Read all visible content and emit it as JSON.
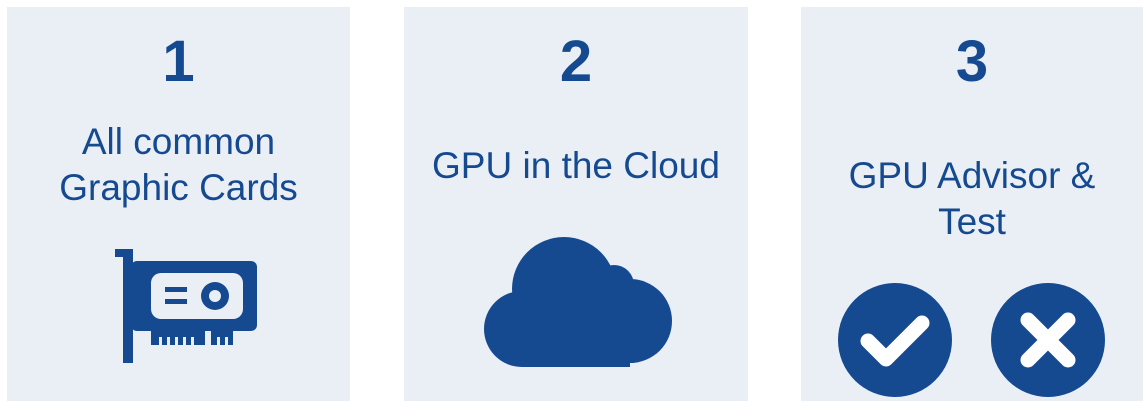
{
  "cards": [
    {
      "number": "1",
      "title": "All common\nGraphic Cards",
      "icon": "graphics-card-icon"
    },
    {
      "number": "2",
      "title": "GPU in the Cloud",
      "icon": "cloud-icon"
    },
    {
      "number": "3",
      "title": "GPU Advisor &\nTest",
      "icons": [
        "checkmark-circle-icon",
        "x-circle-icon"
      ]
    }
  ],
  "colors": {
    "card_background": "#eaeff5",
    "accent": "#154a91"
  }
}
